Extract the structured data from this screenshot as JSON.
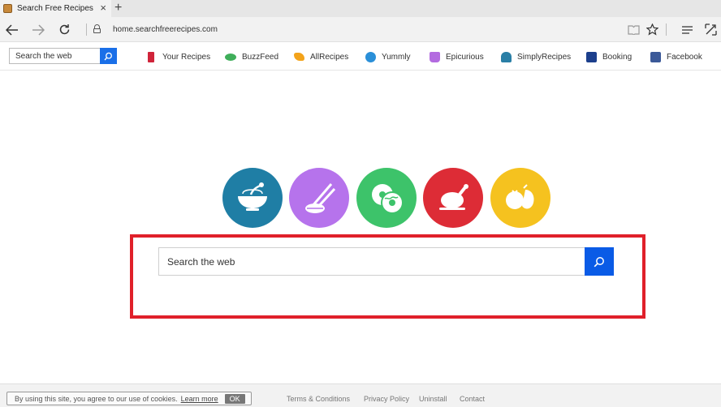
{
  "browser": {
    "tab_title": "Search Free Recipes",
    "tab_close": "×",
    "new_tab": "+",
    "url": "home.searchfreerecipes.com",
    "icons": [
      "back-arrow-icon",
      "forward-arrow-icon",
      "refresh-icon",
      "lock-icon",
      "reading-view-icon",
      "favorite-star-icon",
      "hub-icon",
      "web-note-icon"
    ]
  },
  "toolbar": {
    "search_placeholder": "Search the web",
    "links": [
      {
        "label": "Your Recipes",
        "icon": "mixer-icon",
        "color": "#d0243a"
      },
      {
        "label": "BuzzFeed",
        "icon": "buzzfeed-icon",
        "color": "#3fae5a"
      },
      {
        "label": "AllRecipes",
        "icon": "allrecipes-icon",
        "color": "#f3a31a"
      },
      {
        "label": "Yummly",
        "icon": "yummly-icon",
        "color": "#2a8fd8"
      },
      {
        "label": "Epicurious",
        "icon": "pot-icon",
        "color": "#b36be0"
      },
      {
        "label": "SimplyRecipes",
        "icon": "bowl-icon",
        "color": "#2a7fa6"
      },
      {
        "label": "Booking",
        "icon": "booking-icon",
        "color": "#1c3f8c"
      },
      {
        "label": "Facebook",
        "icon": "facebook-icon",
        "color": "#3b5998"
      }
    ]
  },
  "categories": [
    {
      "name": "bowl-icon",
      "color": "#1f7ea5"
    },
    {
      "name": "chopsticks-icon",
      "color": "#b673ec"
    },
    {
      "name": "donuts-icon",
      "color": "#3dc36a"
    },
    {
      "name": "roast-chicken-icon",
      "color": "#dd2c36"
    },
    {
      "name": "vegetables-icon",
      "color": "#f5c21f"
    }
  ],
  "main": {
    "search_placeholder": "Search the web",
    "accent": "#0a5be6",
    "highlight_color": "#e0202a"
  },
  "footer": {
    "cookie_text": "By using this site, you agree to our use of cookies.",
    "learn_more": "Learn more",
    "ok": "OK",
    "links": [
      "Terms & Conditions",
      "Privacy Policy",
      "Uninstall",
      "Contact"
    ]
  }
}
